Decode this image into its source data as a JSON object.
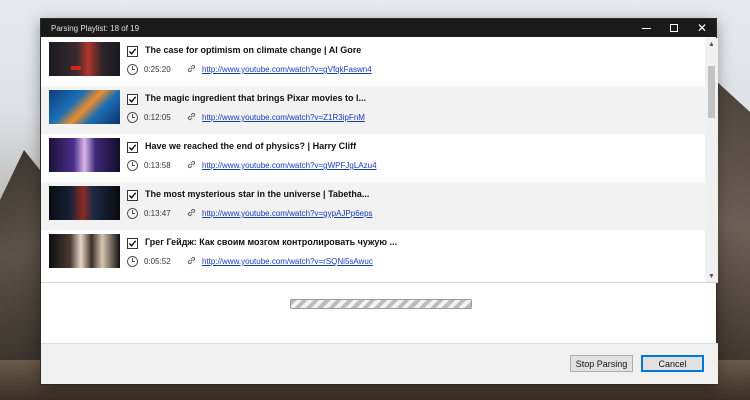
{
  "window": {
    "title": "Parsing Playlist: 18 of 19"
  },
  "videos": [
    {
      "title": "The case for optimism on climate change | Al Gore",
      "duration": "0:25:20",
      "url": "http://www.youtube.com/watch?v=gVfqkFaswn4",
      "checked": true
    },
    {
      "title": "The magic ingredient that brings Pixar movies to l...",
      "duration": "0:12:05",
      "url": "http://www.youtube.com/watch?v=Z1R3ipFnM",
      "checked": true
    },
    {
      "title": "Have we reached the end of physics? | Harry Cliff",
      "duration": "0:13:58",
      "url": "http://www.youtube.com/watch?v=gWPFJgLAzu4",
      "checked": true
    },
    {
      "title": "The most mysterious star in the universe | Tabetha...",
      "duration": "0:13:47",
      "url": "http://www.youtube.com/watch?v=gypAJPp6eps",
      "checked": true
    },
    {
      "title": "Грег Гейдж: Как своим мозгом контролировать чужую ...",
      "duration": "0:05:52",
      "url": "http://www.youtube.com/watch?v=rSQNi5sAwuc",
      "checked": true
    }
  ],
  "icons": {
    "duration": "clock-icon",
    "url": "link-icon",
    "checkbox": "checkmark-icon"
  },
  "buttons": {
    "stop_label": "Stop Parsing",
    "cancel_label": "Cancel"
  },
  "colors": {
    "titlebar": "#1a1a1a",
    "link": "#1a3bb5",
    "accent": "#0078d7"
  }
}
